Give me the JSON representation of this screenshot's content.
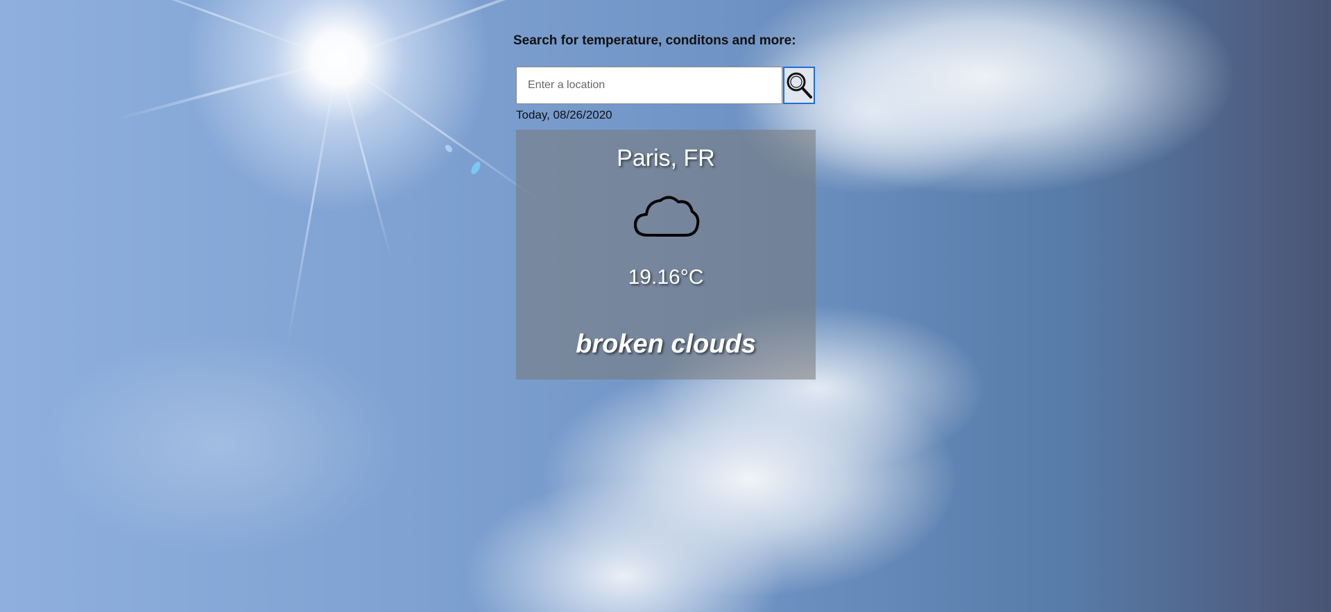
{
  "search": {
    "heading": "Search for temperature, conditons and more:",
    "placeholder": "Enter a location",
    "value": "",
    "button_icon": "magnifier-icon"
  },
  "date_label": "Today, 08/26/2020",
  "weather": {
    "city": "Paris, FR",
    "icon": "cloud-icon",
    "temperature": "19.16°C",
    "description": "broken clouds"
  },
  "colors": {
    "card_background": "#787878",
    "search_button_border": "#1f6fd1",
    "text_dark": "#111111",
    "text_light": "#ffffff"
  }
}
